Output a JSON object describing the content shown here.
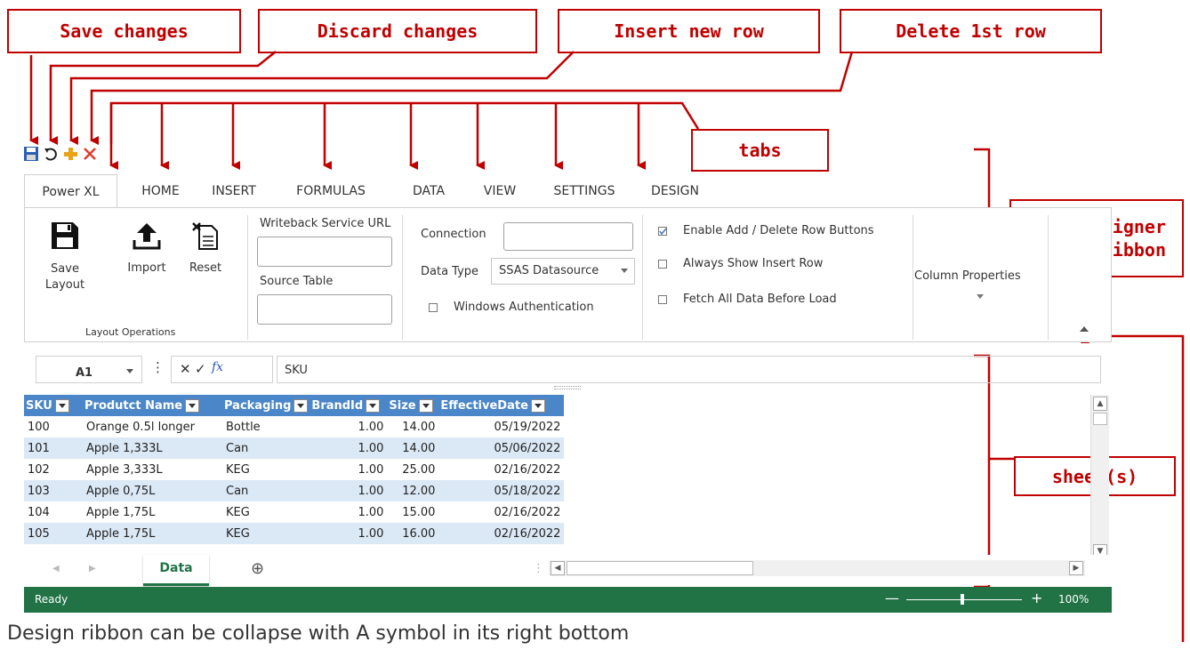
{
  "callouts": {
    "save": "Save changes",
    "discard": "Discard changes",
    "insert": "Insert new row",
    "delete": "Delete 1st row",
    "tabs": "tabs",
    "ribbon_line1": "designer",
    "ribbon_line2": "ribbon",
    "sheets": "sheet(s)"
  },
  "qat": {
    "save_icon": "floppy-disk-icon",
    "discard_icon": "undo-icon",
    "insert_icon": "plus-icon",
    "delete_icon": "x-icon"
  },
  "tabs": [
    "Power XL",
    "HOME",
    "INSERT",
    "FORMULAS",
    "DATA",
    "VIEW",
    "SETTINGS",
    "DESIGN"
  ],
  "ribbon": {
    "save_layout_line1": "Save",
    "save_layout_line2": "Layout",
    "import_label": "Import",
    "reset_label": "Reset",
    "group_label": "Layout Operations",
    "writeback_label": "Writeback Service URL",
    "writeback_value": "",
    "source_table_label": "Source Table",
    "source_table_value": "",
    "connection_label": "Connection",
    "connection_value": "",
    "data_type_label": "Data Type",
    "data_type_value": "SSAS Datasource",
    "windows_auth_label": "Windows Authentication",
    "enable_add_delete_label": "Enable Add / Delete Row Buttons",
    "always_show_insert_label": "Always Show Insert Row",
    "fetch_all_label": "Fetch All Data Before Load",
    "column_properties_label": "Column Properties"
  },
  "formula_bar": {
    "cell_ref": "A1",
    "fx": "fx",
    "value": "SKU"
  },
  "sheet": {
    "columns": [
      "SKU",
      "Produtct Name",
      "Packaging",
      "BrandId",
      "Size",
      "EffectiveDate"
    ],
    "rows": [
      [
        "100",
        "Orange 0.5l longer",
        "Bottle",
        "1.00",
        "14.00",
        "05/19/2022"
      ],
      [
        "101",
        "Apple 1,333L",
        "Can",
        "1.00",
        "14.00",
        "05/06/2022"
      ],
      [
        "102",
        "Apple 3,333L",
        "KEG",
        "1.00",
        "25.00",
        "02/16/2022"
      ],
      [
        "103",
        "Apple 0,75L",
        "Can",
        "1.00",
        "12.00",
        "05/18/2022"
      ],
      [
        "104",
        "Apple 1,75L",
        "KEG",
        "1.00",
        "15.00",
        "02/16/2022"
      ],
      [
        "105",
        "Apple 1,75L",
        "KEG",
        "1.00",
        "16.00",
        "02/16/2022"
      ]
    ]
  },
  "sheet_tabs": [
    "Data"
  ],
  "status": {
    "text": "Ready",
    "zoom": "100%"
  },
  "note": "Design ribbon can be collapse with A symbol in its right bottom",
  "colors": {
    "annotation": "#c00000",
    "header": "#4a86c8",
    "alt_row": "#dbe8f5",
    "status_bar": "#217346"
  }
}
